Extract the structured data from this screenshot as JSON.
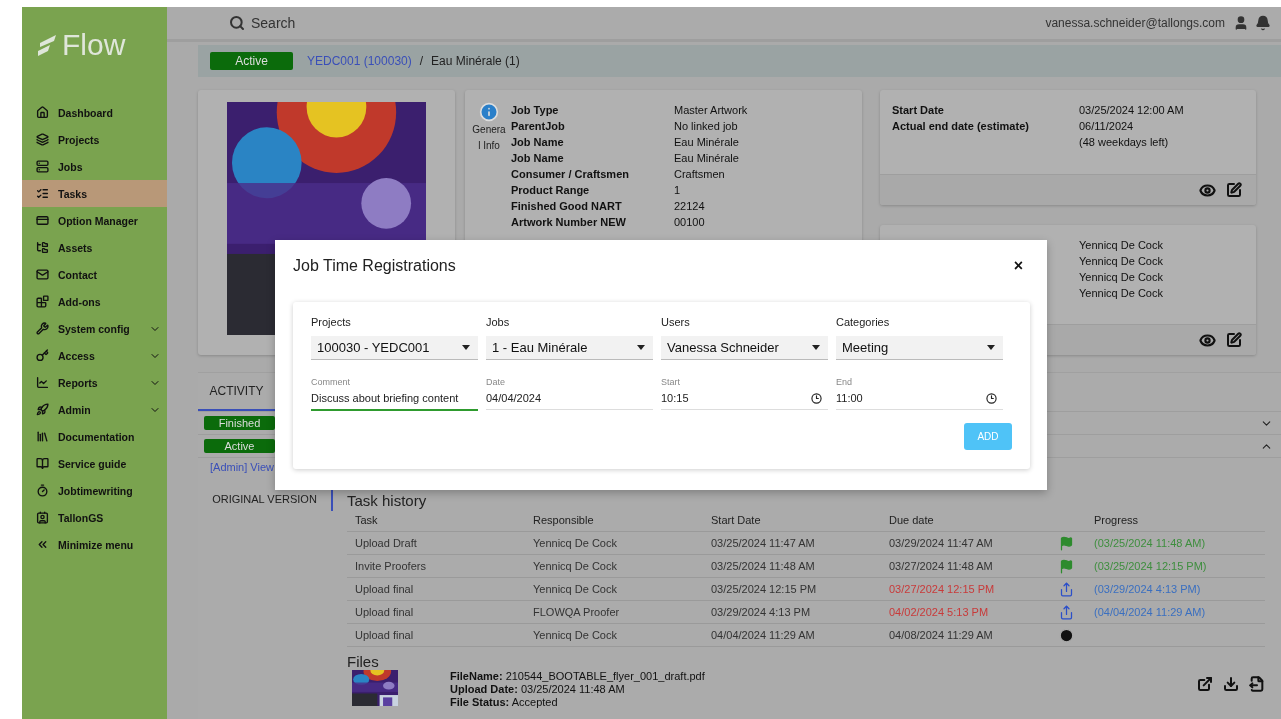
{
  "sidebar": {
    "logo": "Flow",
    "items": [
      {
        "label": "Dashboard",
        "selected": false,
        "has_submenu": false
      },
      {
        "label": "Projects",
        "selected": false,
        "has_submenu": false
      },
      {
        "label": "Jobs",
        "selected": false,
        "has_submenu": false
      },
      {
        "label": "Tasks",
        "selected": true,
        "has_submenu": false
      },
      {
        "label": "Option Manager",
        "selected": false,
        "has_submenu": false
      },
      {
        "label": "Assets",
        "selected": false,
        "has_submenu": false
      },
      {
        "label": "Contact",
        "selected": false,
        "has_submenu": false
      },
      {
        "label": "Add-ons",
        "selected": false,
        "has_submenu": false
      },
      {
        "label": "System config",
        "selected": false,
        "has_submenu": true
      },
      {
        "label": "Access",
        "selected": false,
        "has_submenu": true
      },
      {
        "label": "Reports",
        "selected": false,
        "has_submenu": true
      },
      {
        "label": "Admin",
        "selected": false,
        "has_submenu": true
      },
      {
        "label": "Documentation",
        "selected": false,
        "has_submenu": false
      },
      {
        "label": "Service guide",
        "selected": false,
        "has_submenu": false
      },
      {
        "label": "Jobtimewriting",
        "selected": false,
        "has_submenu": false
      },
      {
        "label": "TallonGS",
        "selected": false,
        "has_submenu": false
      },
      {
        "label": "Minimize menu",
        "selected": false,
        "has_submenu": false
      }
    ]
  },
  "topbar": {
    "search_placeholder": "Search",
    "user_email": "vanessa.schneider@tallongs.com"
  },
  "breadcrumb": {
    "status": "Active",
    "link": "YEDC001 (100030)",
    "separator": "/",
    "current": "Eau Minérale (1)"
  },
  "general_info": {
    "caption": "General Info",
    "rows": [
      {
        "label": "Job Type",
        "value": "Master Artwork"
      },
      {
        "label": "ParentJob",
        "value": "No linked job"
      },
      {
        "label": "Job Name",
        "value": "Eau Minérale"
      },
      {
        "label": "Job Name",
        "value": "Eau Minérale"
      },
      {
        "label": "Consumer / Craftsmen",
        "value": "Craftsmen"
      },
      {
        "label": "Product Range",
        "value": "1"
      },
      {
        "label": "Finished Good NART",
        "value": "22124"
      },
      {
        "label": "Artwork Number NEW",
        "value": "00100"
      }
    ]
  },
  "dates": {
    "rows": [
      {
        "label": "Start Date",
        "value": "03/25/2024 12:00 AM"
      },
      {
        "label": "Actual end date (estimate)",
        "value": "06/11/2024"
      },
      {
        "label": "",
        "value": "(48 weekdays left)"
      }
    ]
  },
  "people": {
    "values": [
      "Yennicq De Cock",
      "Yennicq De Cock",
      "Yennicq De Cock",
      "Yennicq De Cock"
    ]
  },
  "activity": {
    "tabs": [
      {
        "label": "ACTIVITY",
        "selected": true
      }
    ],
    "status_rows": [
      {
        "status": "Finished",
        "expanded": false
      },
      {
        "status": "Active",
        "expanded": true
      }
    ],
    "admin_link": "[Admin] View",
    "versions": [
      {
        "label": "ORIGINAL VERSION",
        "selected": true
      }
    ],
    "task_history": {
      "title": "Task history",
      "columns": [
        "Task",
        "Responsible",
        "Start Date",
        "Due date",
        "Progress"
      ],
      "rows": [
        {
          "task": "Upload Draft",
          "responsible": "Yennicq De Cock",
          "start": "03/25/2024 11:47 AM",
          "due": "03/29/2024 11:47 AM",
          "overdue": false,
          "kind": "finished",
          "progress": "(03/25/2024 11:48 AM)"
        },
        {
          "task": "Invite Proofers",
          "responsible": "Yennicq De Cock",
          "start": "03/25/2024 11:48 AM",
          "due": "03/27/2024 11:48 AM",
          "overdue": false,
          "kind": "finished",
          "progress": "(03/25/2024 12:15 PM)"
        },
        {
          "task": "Upload final",
          "responsible": "Yennicq De Cock",
          "start": "03/25/2024 12:15 PM",
          "due": "03/27/2024 12:15 PM",
          "overdue": true,
          "kind": "forwarded",
          "progress": "(03/29/2024 4:13 PM)"
        },
        {
          "task": "Upload final",
          "responsible": "FLOWQA Proofer",
          "start": "03/29/2024 4:13 PM",
          "due": "04/02/2024 5:13 PM",
          "overdue": true,
          "kind": "forwarded",
          "progress": "(04/04/2024 11:29 AM)"
        },
        {
          "task": "Upload final",
          "responsible": "Yennicq De Cock",
          "start": "04/04/2024 11:29 AM",
          "due": "04/08/2024 11:29 AM",
          "overdue": false,
          "kind": "pending"
        }
      ]
    },
    "files": {
      "title": "Files",
      "items": [
        {
          "lines": [
            "**FileName:** 210544_BOOTABLE_flyer_001_draft.pdf",
            "**Upload Date:** 03/25/2024 11:48 AM",
            "**File Status:** Accepted"
          ]
        }
      ]
    }
  },
  "dialog": {
    "title": "Job Time Registrations",
    "close": "×",
    "selects": [
      {
        "label": "Projects",
        "value": "100030 - YEDC001"
      },
      {
        "label": "Jobs",
        "value": "1 - Eau Minérale"
      },
      {
        "label": "Users",
        "value": "Vanessa Schneider"
      },
      {
        "label": "Categories",
        "value": "Meeting"
      }
    ],
    "fields": [
      {
        "label": "Comment",
        "value": "Discuss about briefing content",
        "kind": "text",
        "focused": true
      },
      {
        "label": "Date",
        "value": "04/04/2024",
        "kind": "date",
        "focused": false
      },
      {
        "label": "Start",
        "value": "10:15",
        "kind": "time",
        "focused": false
      },
      {
        "label": "End",
        "value": "11:00",
        "kind": "time",
        "focused": false
      }
    ],
    "button": "ADD"
  }
}
